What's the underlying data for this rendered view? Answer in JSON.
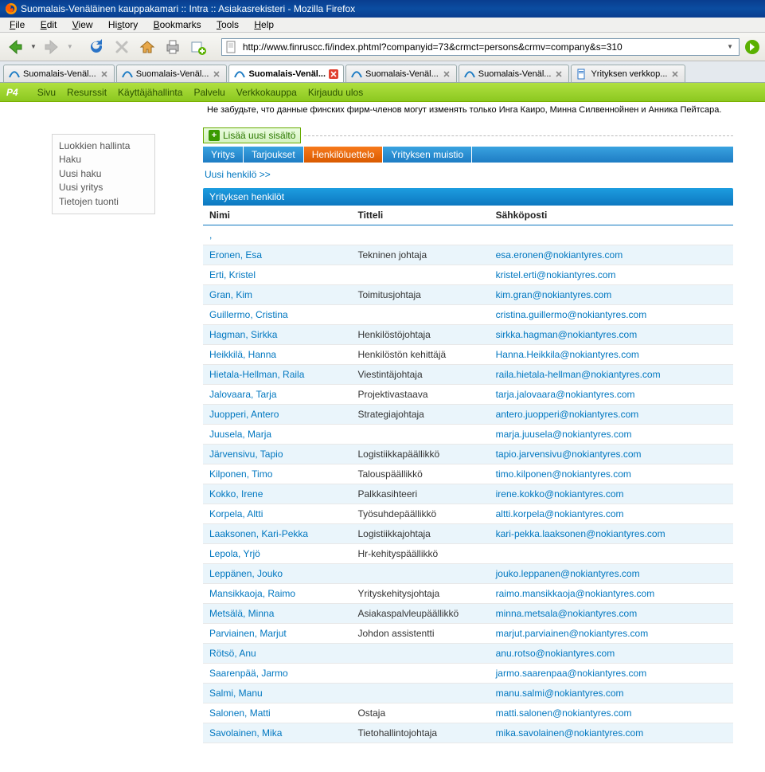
{
  "window": {
    "title": "Suomalais-Venäläinen kauppakamari :: Intra :: Asiakasrekisteri - Mozilla Firefox"
  },
  "menubar": {
    "file": "File",
    "edit": "Edit",
    "view": "View",
    "history": "History",
    "bookmarks": "Bookmarks",
    "tools": "Tools",
    "help": "Help"
  },
  "url": "http://www.finruscc.fi/index.phtml?companyid=73&crmct=persons&crmv=company&s=310",
  "tabs": [
    {
      "label": "Suomalais-Venäl...",
      "active": false,
      "icon": "swoosh"
    },
    {
      "label": "Suomalais-Venäl...",
      "active": false,
      "icon": "swoosh"
    },
    {
      "label": "Suomalais-Venäl...",
      "active": true,
      "icon": "swoosh"
    },
    {
      "label": "Suomalais-Venäl...",
      "active": false,
      "icon": "swoosh"
    },
    {
      "label": "Suomalais-Venäl...",
      "active": false,
      "icon": "swoosh"
    },
    {
      "label": "Yrityksen verkkop...",
      "active": false,
      "icon": "doc"
    }
  ],
  "appnav": {
    "logo": "P4",
    "items": [
      "Sivu",
      "Resurssit",
      "Käyttäjähallinta",
      "Palvelu",
      "Verkkokauppa",
      "Kirjaudu ulos"
    ]
  },
  "notice": "Не забудьте, что данные финских фирм-членов могут изменять только Инга Каиро, Минна Силвеннойнен и Анника Пейтсара.",
  "sidebar": {
    "items": [
      "Luokkien hallinta",
      "Haku",
      "Uusi haku",
      "Uusi yritys",
      "Tietojen tuonti"
    ]
  },
  "addbtn": "Lisää uusi sisältö",
  "subtabs": [
    {
      "label": "Yritys",
      "active": false
    },
    {
      "label": "Tarjoukset",
      "active": false
    },
    {
      "label": "Henkilöluettelo",
      "active": true
    },
    {
      "label": "Yrityksen muistio",
      "active": false
    }
  ],
  "newperson": "Uusi henkilö >>",
  "panel": {
    "title": "Yrityksen henkilöt",
    "columns": {
      "name": "Nimi",
      "title": "Titteli",
      "email": "Sähköposti"
    },
    "rows": [
      {
        "name": ",",
        "title": "",
        "email": ""
      },
      {
        "name": "Eronen, Esa",
        "title": "Tekninen johtaja",
        "email": "esa.eronen@nokiantyres.com"
      },
      {
        "name": "Erti, Kristel",
        "title": "",
        "email": "kristel.erti@nokiantyres.com"
      },
      {
        "name": "Gran, Kim",
        "title": "Toimitusjohtaja",
        "email": "kim.gran@nokiantyres.com"
      },
      {
        "name": "Guillermo, Cristina",
        "title": "",
        "email": "cristina.guillermo@nokiantyres.com"
      },
      {
        "name": "Hagman, Sirkka",
        "title": "Henkilöstöjohtaja",
        "email": "sirkka.hagman@nokiantyres.com"
      },
      {
        "name": "Heikkilä, Hanna",
        "title": "Henkilöstön kehittäjä",
        "email": "Hanna.Heikkila@nokiantyres.com"
      },
      {
        "name": "Hietala-Hellman, Raila",
        "title": "Viestintäjohtaja",
        "email": "raila.hietala-hellman@nokiantyres.com"
      },
      {
        "name": "Jalovaara, Tarja",
        "title": "Projektivastaava",
        "email": "tarja.jalovaara@nokiantyres.com"
      },
      {
        "name": "Juopperi, Antero",
        "title": "Strategiajohtaja",
        "email": "antero.juopperi@nokiantyres.com"
      },
      {
        "name": "Juusela, Marja",
        "title": "",
        "email": "marja.juusela@nokiantyres.com"
      },
      {
        "name": "Järvensivu, Tapio",
        "title": "Logistiikkapäällikkö",
        "email": "tapio.jarvensivu@nokiantyres.com"
      },
      {
        "name": "Kilponen, Timo",
        "title": "Talouspäällikkö",
        "email": "timo.kilponen@nokiantyres.com"
      },
      {
        "name": "Kokko, Irene",
        "title": "Palkkasihteeri",
        "email": "irene.kokko@nokiantyres.com"
      },
      {
        "name": "Korpela, Altti",
        "title": "Työsuhdepäällikkö",
        "email": "altti.korpela@nokiantyres.com"
      },
      {
        "name": "Laaksonen, Kari-Pekka",
        "title": "Logistiikkajohtaja",
        "email": "kari-pekka.laaksonen@nokiantyres.com"
      },
      {
        "name": "Lepola, Yrjö",
        "title": "Hr-kehityspäällikkö",
        "email": ""
      },
      {
        "name": "Leppänen, Jouko",
        "title": "",
        "email": "jouko.leppanen@nokiantyres.com"
      },
      {
        "name": "Mansikkaoja, Raimo",
        "title": "Yrityskehitysjohtaja",
        "email": "raimo.mansikkaoja@nokiantyres.com"
      },
      {
        "name": "Metsälä, Minna",
        "title": "Asiakaspalvleupäällikkö",
        "email": "minna.metsala@nokiantyres.com"
      },
      {
        "name": "Parviainen, Marjut",
        "title": "Johdon assistentti",
        "email": "marjut.parviainen@nokiantyres.com"
      },
      {
        "name": "Rötsö, Anu",
        "title": "",
        "email": "anu.rotso@nokiantyres.com"
      },
      {
        "name": "Saarenpää, Jarmo",
        "title": "",
        "email": "jarmo.saarenpaa@nokiantyres.com"
      },
      {
        "name": "Salmi, Manu",
        "title": "",
        "email": "manu.salmi@nokiantyres.com"
      },
      {
        "name": "Salonen, Matti",
        "title": "Ostaja",
        "email": "matti.salonen@nokiantyres.com"
      },
      {
        "name": "Savolainen, Mika",
        "title": "Tietohallintojohtaja",
        "email": "mika.savolainen@nokiantyres.com"
      }
    ]
  }
}
